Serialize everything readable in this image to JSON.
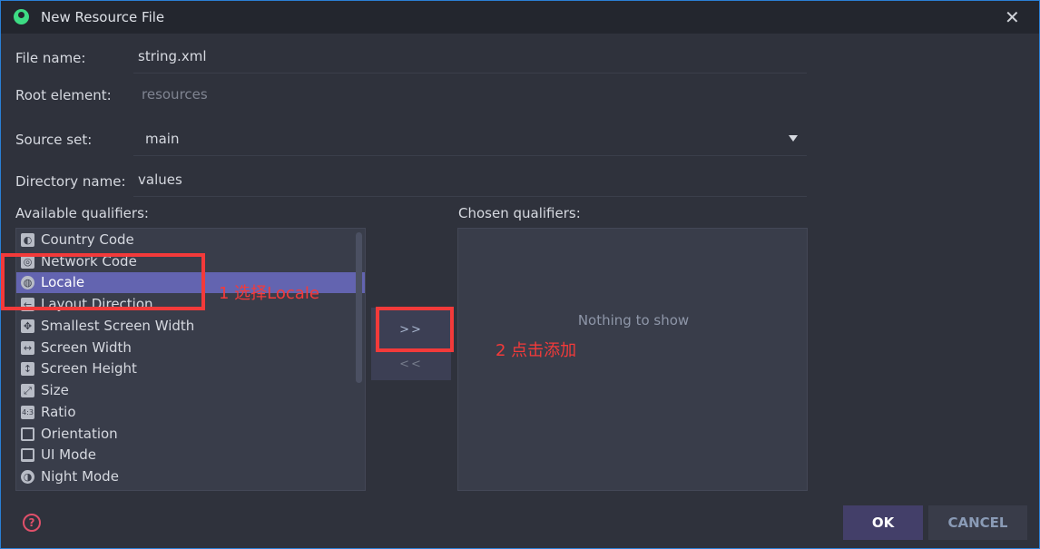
{
  "window": {
    "title": "New Resource File",
    "close_icon": "close-icon",
    "app_icon": "android-studio-icon"
  },
  "form": {
    "file_name": {
      "label": "File name:",
      "value": "string.xml"
    },
    "root_element": {
      "label": "Root element:",
      "placeholder": "resources"
    },
    "source_set": {
      "label": "Source set:",
      "value": "main"
    },
    "directory_name": {
      "label": "Directory name:",
      "value": "values"
    }
  },
  "available": {
    "label": "Available qualifiers:",
    "items": [
      {
        "label": "Country Code",
        "icon": "country-code-icon"
      },
      {
        "label": "Network Code",
        "icon": "network-code-icon"
      },
      {
        "label": "Locale",
        "icon": "globe-icon",
        "selected": true
      },
      {
        "label": "Layout Direction",
        "icon": "layout-direction-icon"
      },
      {
        "label": "Smallest Screen Width",
        "icon": "move-arrows-icon"
      },
      {
        "label": "Screen Width",
        "icon": "horizontal-arrows-icon"
      },
      {
        "label": "Screen Height",
        "icon": "vertical-arrows-icon"
      },
      {
        "label": "Size",
        "icon": "diagonal-arrow-icon"
      },
      {
        "label": "Ratio",
        "icon": "ratio-icon"
      },
      {
        "label": "Orientation",
        "icon": "orientation-icon"
      },
      {
        "label": "UI Mode",
        "icon": "ui-mode-icon"
      },
      {
        "label": "Night Mode",
        "icon": "night-mode-icon"
      }
    ]
  },
  "transfer": {
    "add": ">>",
    "remove": "<<"
  },
  "chosen": {
    "label": "Chosen qualifiers:",
    "empty": "Nothing to show"
  },
  "footer": {
    "ok": "OK",
    "cancel": "CANCEL",
    "help": "?"
  },
  "annotations": {
    "step1": "1 选择Locale",
    "step2": "2 点击添加",
    "color": "#f33a3a"
  },
  "colors": {
    "selection": "#6364b0",
    "accent_border": "#2a7fd4"
  }
}
